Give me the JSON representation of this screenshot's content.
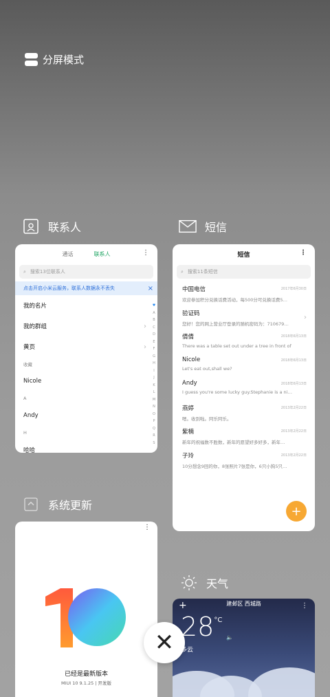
{
  "split_mode": {
    "label": "分屏模式"
  },
  "contacts": {
    "app_name": "联系人",
    "tabs": [
      "通话",
      "联系人"
    ],
    "search_placeholder": "搜索13位联系人",
    "banner": "点击开启小米云服务，联系人数据永不丢失",
    "banner_close": "×",
    "rows": [
      {
        "label": "我的名片",
        "type": "item"
      },
      {
        "label": "我的群组",
        "type": "item",
        "chevron": "›"
      },
      {
        "label": "黄页",
        "type": "item",
        "chevron": "›"
      },
      {
        "label": "收藏",
        "type": "section"
      },
      {
        "label": "Nicole",
        "type": "item"
      },
      {
        "label": "A",
        "type": "section"
      },
      {
        "label": "Andy",
        "type": "item"
      },
      {
        "label": "H",
        "type": "section"
      },
      {
        "label": "哈哈",
        "type": "item"
      }
    ],
    "alphabet": [
      "♥",
      "A",
      "B",
      "C",
      "D",
      "E",
      "F",
      "G",
      "H",
      "I",
      "J",
      "K",
      "L",
      "M",
      "N",
      "O",
      "P",
      "Q",
      "R",
      "S"
    ]
  },
  "sms": {
    "app_name": "短信",
    "title": "短信",
    "search_placeholder": "搜索11条短信",
    "messages": [
      {
        "name": "中国电信",
        "preview": "欢迎参加积分兑换话费活动，每500分可兑换话费5…",
        "date": "2017年6月30日"
      },
      {
        "name": "验证码",
        "preview": "您好！您的网上营业厅登录的随机密码为：710679…",
        "date": ""
      },
      {
        "name": "倩倩",
        "preview": "There was a table set out under a tree in front of …",
        "date": "2018年6月13日"
      },
      {
        "name": "Nicole",
        "preview": "Let's eat out,shall we?",
        "date": "2018年6月13日"
      },
      {
        "name": "Andy",
        "preview": "I guess you're some lucky guy.Stephanie is a ni…",
        "date": "2018年6月13日"
      },
      {
        "name": "燕婷",
        "preview": "嗯。收到啦。阿乐阿乐。",
        "date": "2013年2月22日"
      },
      {
        "name": "紫楠",
        "preview": "新年的祝福数不胜数，新年的愿望好多好多，新年…",
        "date": "2013年2月22日"
      },
      {
        "name": "子玲",
        "preview": "10分想念9回的你，8张照片7张是你，6只小狗5只…",
        "date": "2013年2月22日"
      }
    ],
    "fab": "+"
  },
  "update": {
    "app_name": "系统更新",
    "status": "已经是最新版本",
    "version": "MIUI 10 9.1.25 | 开发版",
    "logo_colors": [
      "#ff5a3c",
      "#ff9b2e",
      "#49c6f2",
      "#7a5cf0"
    ]
  },
  "weather": {
    "app_name": "天气",
    "location": "建邺区 西城路",
    "temperature": "28",
    "unit": "°C",
    "condition": "多云"
  },
  "close": {
    "label": "✕"
  }
}
